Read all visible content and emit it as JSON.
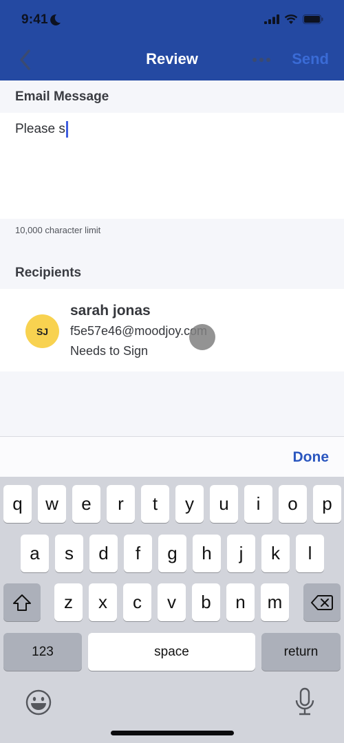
{
  "status_bar": {
    "time": "9:41",
    "moon_icon": "moon-icon",
    "icons": [
      "signal-icon",
      "wifi-icon",
      "battery-icon"
    ]
  },
  "nav": {
    "title": "Review",
    "send_label": "Send",
    "back_icon": "chevron-left-icon",
    "more_icon": "ellipsis-icon"
  },
  "message": {
    "section_label": "Email Message",
    "value": "Please s",
    "char_limit": "10,000 character limit"
  },
  "recipients": {
    "section_label": "Recipients",
    "items": [
      {
        "initials": "SJ",
        "name": "sarah jonas",
        "email": "f5e57e46@moodjoy.com",
        "status": "Needs to Sign",
        "avatar_color": "#f8d250"
      }
    ]
  },
  "accessory": {
    "done_label": "Done"
  },
  "keyboard": {
    "row1": [
      "q",
      "w",
      "e",
      "r",
      "t",
      "y",
      "u",
      "i",
      "o",
      "p"
    ],
    "row2": [
      "a",
      "s",
      "d",
      "f",
      "g",
      "h",
      "j",
      "k",
      "l"
    ],
    "row3": [
      "z",
      "x",
      "c",
      "v",
      "b",
      "n",
      "m"
    ],
    "numbers_label": "123",
    "space_label": "space",
    "return_label": "return"
  },
  "colors": {
    "header": "#2449a2",
    "accent": "#2a56bf",
    "send_disabled": "#3a6bd6"
  }
}
